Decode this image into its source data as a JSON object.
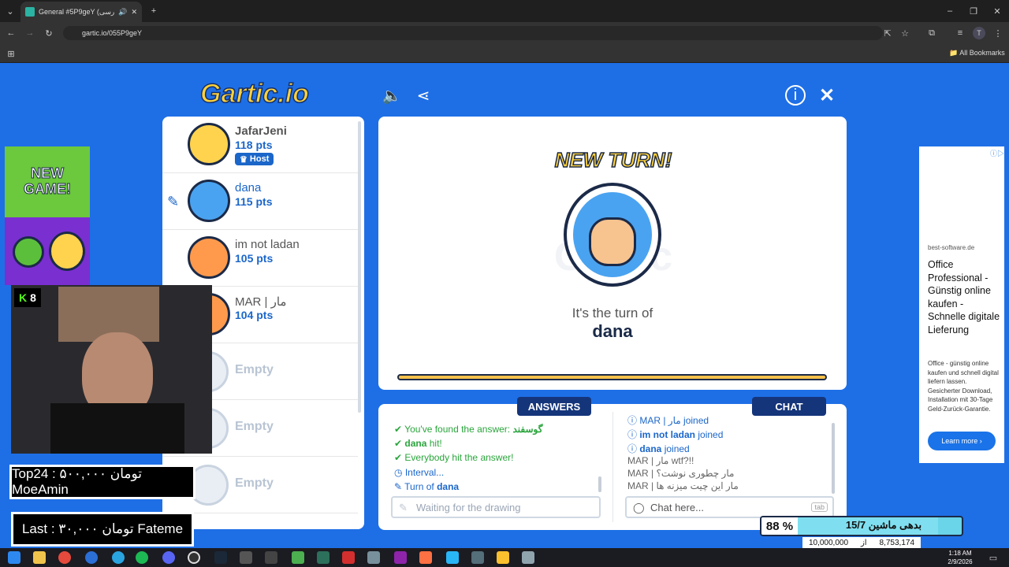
{
  "browser": {
    "tab_title": "General #5P9geY (فارسی) -",
    "url": "gartic.io/055P9geY",
    "bookmarks_label": "All Bookmarks",
    "profile_initial": "T"
  },
  "game": {
    "logo": "Gartic.io",
    "players": [
      {
        "name": "JafarJeni",
        "points": "118 pts",
        "badge": "Host",
        "avatar_color": "#ffd34d"
      },
      {
        "name": "dana",
        "points": "115 pts",
        "avatar_color": "#4aa3f0"
      },
      {
        "name": "im not ladan",
        "points": "105 pts",
        "avatar_color": "#ff9a4d"
      },
      {
        "name": "MAR | مار",
        "points": "104 pts",
        "avatar_color": "#ff9a4d"
      }
    ],
    "empty_label": "Empty",
    "stage": {
      "banner": "NEW TURN!",
      "turn_text": "It's the turn of",
      "turn_player": "dana",
      "timer_fraction": 1.0
    },
    "answers_header": "ANSWERS",
    "chat_header": "CHAT",
    "answers": [
      {
        "text": "You've found the answer:",
        "extra": "گوسفند",
        "kind": "green"
      },
      {
        "text": "dana",
        "extra": "hit!",
        "kind": "green"
      },
      {
        "text": "Everybody hit the answer!",
        "kind": "green"
      },
      {
        "text": "Interval...",
        "kind": "blue"
      },
      {
        "text": "Turn of",
        "extra": "dana",
        "kind": "blue"
      }
    ],
    "answer_placeholder": "Waiting for the drawing",
    "chat": [
      {
        "text": "MAR | مار joined",
        "kind": "blue"
      },
      {
        "user": "im not ladan",
        "text": "joined",
        "kind": "blue"
      },
      {
        "user": "dana",
        "text": "joined",
        "kind": "blue"
      },
      {
        "user": "MAR |",
        "text": "مار wtf?!!",
        "kind": "gray"
      },
      {
        "user": "MAR |",
        "text": "مار چطوری نوشت؟",
        "kind": "gray"
      },
      {
        "user": "MAR |",
        "text": "مار این چیت میزنه ها",
        "kind": "gray"
      }
    ],
    "chat_placeholder": "Chat here...",
    "chat_key": "tab"
  },
  "ads": {
    "left_promo": "NEW GAME!",
    "right": {
      "domain": "best-software.de",
      "headline": "Office Professional - Günstig online kaufen - Schnelle digitale Lieferung",
      "body": "Office - günstig online kaufen und schnell digital liefern lassen. Gesicherter Download, Installation mit 30-Tage Geld-Zurück-Garantie.",
      "cta": "Learn more"
    }
  },
  "stream_overlay": {
    "kick_count": "8",
    "top_donor": "Top24 : ۵۰۰,۰۰۰ تومان MoeAmin",
    "last_donor": "Last : ۳۰,۰۰۰ تومان Fateme",
    "goal_title": "بدهی ماشین 15/7",
    "goal_percent": "88",
    "goal_current": "8,753,174",
    "goal_sep": "از",
    "goal_target": "10,000,000",
    "goal_fraction": 0.88
  },
  "taskbar": {
    "time": "1:18 AM",
    "date": "2/9/2026"
  }
}
